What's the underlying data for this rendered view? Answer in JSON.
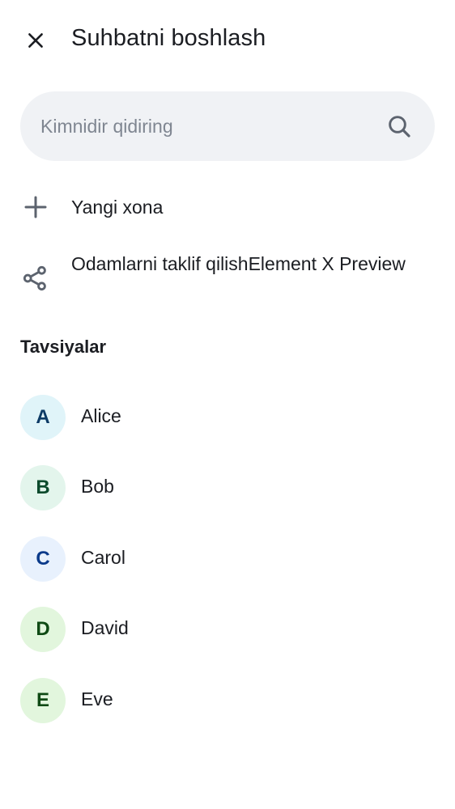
{
  "header": {
    "title": "Suhbatni boshlash",
    "close_icon": "close-icon"
  },
  "search": {
    "placeholder": "Kimnidir qidiring",
    "value": "",
    "icon": "search-icon"
  },
  "actions": [
    {
      "label": "Yangi xona",
      "icon": "plus-icon"
    },
    {
      "label": "Odamlarni taklif qilishElement X Preview",
      "icon": "share-icon"
    }
  ],
  "suggestions": {
    "title": "Tavsiyalar",
    "contacts": [
      {
        "initial": "A",
        "name": "Alice",
        "avatar_bg": "#e0f4f9",
        "avatar_fg": "#0d3b66"
      },
      {
        "initial": "B",
        "name": "Bob",
        "avatar_bg": "#e3f5ec",
        "avatar_fg": "#0b4a2c"
      },
      {
        "initial": "C",
        "name": "Carol",
        "avatar_bg": "#e8f1fd",
        "avatar_fg": "#0a3a8a"
      },
      {
        "initial": "D",
        "name": "David",
        "avatar_bg": "#e2f6dd",
        "avatar_fg": "#0f4a14"
      },
      {
        "initial": "E",
        "name": "Eve",
        "avatar_bg": "#e2f6dd",
        "avatar_fg": "#0f4a14"
      }
    ]
  }
}
